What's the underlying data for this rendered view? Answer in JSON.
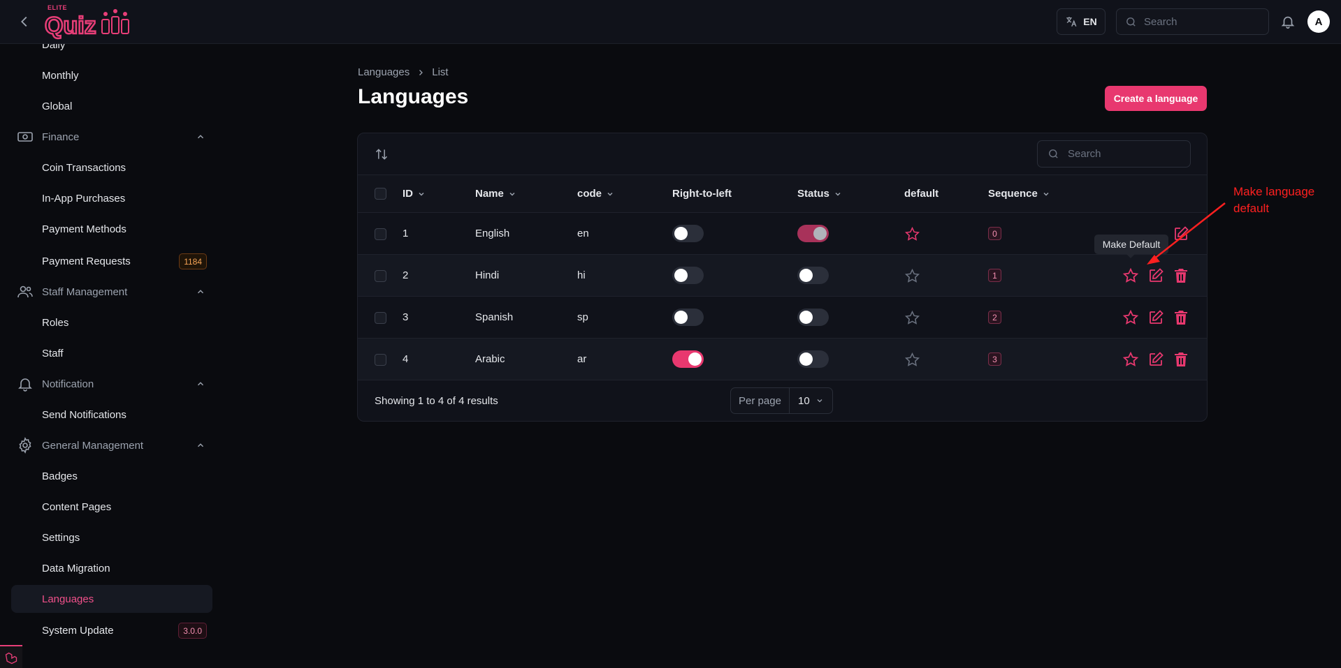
{
  "header": {
    "logo_text": "Quiz",
    "logo_tag": "ELITE",
    "lang_code": "EN",
    "search_placeholder": "Search",
    "avatar_initial": "A"
  },
  "sidebar": {
    "items": [
      {
        "label": "Daily"
      },
      {
        "label": "Monthly"
      },
      {
        "label": "Global"
      },
      {
        "group": "Finance"
      },
      {
        "label": "Coin Transactions"
      },
      {
        "label": "In-App Purchases"
      },
      {
        "label": "Payment Methods"
      },
      {
        "label": "Payment Requests",
        "badge": "1184"
      },
      {
        "group": "Staff Management"
      },
      {
        "label": "Roles"
      },
      {
        "label": "Staff"
      },
      {
        "group": "Notification"
      },
      {
        "label": "Send Notifications"
      },
      {
        "group": "General Management"
      },
      {
        "label": "Badges"
      },
      {
        "label": "Content Pages"
      },
      {
        "label": "Settings"
      },
      {
        "label": "Data Migration"
      },
      {
        "label": "Languages",
        "active": true
      },
      {
        "label": "System Update",
        "badge": "3.0.0"
      }
    ]
  },
  "breadcrumb": {
    "first": "Languages",
    "second": "List"
  },
  "page": {
    "title": "Languages",
    "create_label": "Create a language"
  },
  "table": {
    "search_placeholder": "Search",
    "columns": {
      "id": "ID",
      "name": "Name",
      "code": "code",
      "rtl": "Right-to-left",
      "status": "Status",
      "default": "default",
      "sequence": "Sequence"
    },
    "rows": [
      {
        "id": "1",
        "name": "English",
        "code": "en",
        "rtl": false,
        "status": true,
        "is_default": true,
        "sequence": "0"
      },
      {
        "id": "2",
        "name": "Hindi",
        "code": "hi",
        "rtl": false,
        "status": false,
        "is_default": false,
        "sequence": "1"
      },
      {
        "id": "3",
        "name": "Spanish",
        "code": "sp",
        "rtl": false,
        "status": false,
        "is_default": false,
        "sequence": "2"
      },
      {
        "id": "4",
        "name": "Arabic",
        "code": "ar",
        "rtl": true,
        "status": false,
        "is_default": false,
        "sequence": "3"
      }
    ],
    "showing": "Showing 1 to 4 of 4 results",
    "per_page_label": "Per page",
    "per_page_value": "10"
  },
  "tooltip": "Make Default",
  "annotation": {
    "line1": "Make language",
    "line2": "default"
  },
  "colors": {
    "accent": "#e8386f",
    "bg": "#0a0b0f",
    "panel": "#10121a",
    "annotation": "#ff2020"
  }
}
